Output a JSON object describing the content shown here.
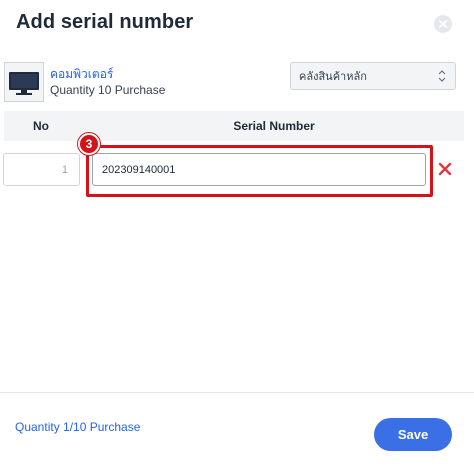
{
  "modal": {
    "title": "Add serial number",
    "close_icon": "close-icon"
  },
  "product": {
    "name": "คอมพิวเตอร์",
    "quantity_label": "Quantity 10 Purchase",
    "thumbnail_icon": "monitor-icon",
    "warehouse_selected": "คลังสินค้าหลัก",
    "warehouse_caret_icon": "sort-caret-icon"
  },
  "table": {
    "columns": [
      "No",
      "Serial Number"
    ],
    "rows": [
      {
        "no": "1",
        "serial_number": "202309140001"
      }
    ],
    "delete_icon": "delete-x-icon"
  },
  "annotation": {
    "step_number": "3",
    "highlight_color": "#d3121a"
  },
  "footer": {
    "quantity_status": "Quantity 1/10 Purchase",
    "save_label": "Save"
  },
  "colors": {
    "accent": "#3b6fe6",
    "link": "#2563eb",
    "danger": "#d3121a"
  }
}
